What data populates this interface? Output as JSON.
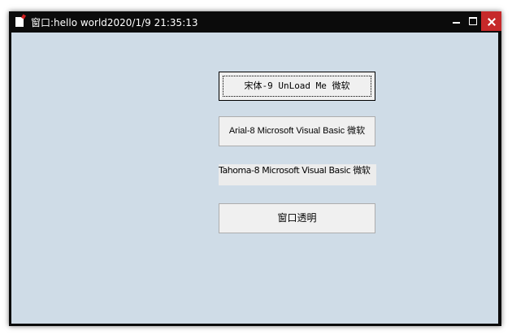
{
  "window": {
    "title": "窗口:hello world2020/1/9 21:35:13"
  },
  "titlebar_controls": {
    "minimize": "minimize",
    "maximize": "maximize",
    "close": "close"
  },
  "controls": {
    "button1_label": "宋体-9 UnLoad Me 微软",
    "button2_label": "Arial-8 Microsoft Visual Basic 微软",
    "label_text": "Tahoma-8 Microsoft Visual Basic 微软",
    "button3_label": "窗口透明"
  },
  "colors": {
    "titlebar": "#0b0b0b",
    "client_background": "#cfdce7",
    "close_button": "#c6292a",
    "button_face": "#f0f0f0"
  }
}
